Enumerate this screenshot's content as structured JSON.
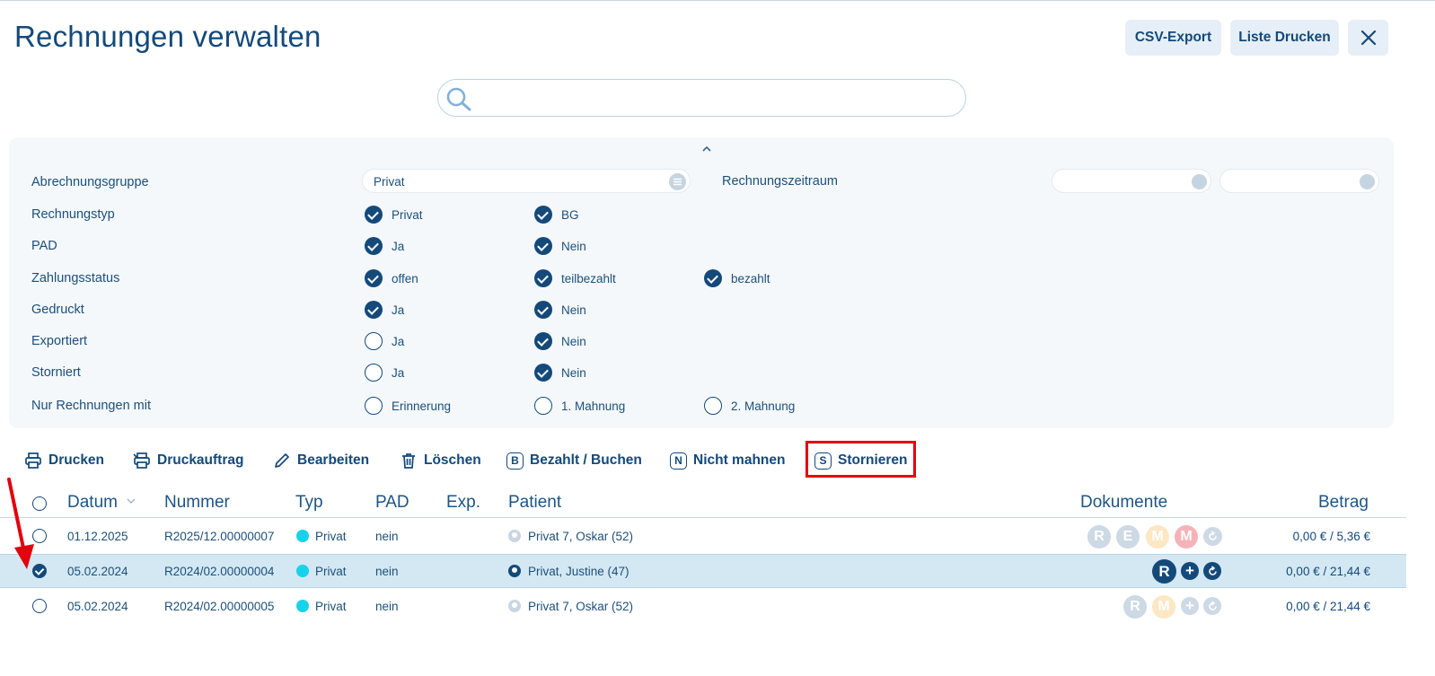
{
  "header": {
    "title": "Rechnungen verwalten",
    "csv_export_label": "CSV-Export",
    "print_list_label": "Liste Drucken",
    "close_label": "✕"
  },
  "search": {
    "value": "",
    "placeholder": ""
  },
  "filters": {
    "collapse_label": "⌃",
    "abrechnungsgruppe": {
      "label": "Abrechnungsgruppe",
      "value": "Privat"
    },
    "rechnungszeitraum": {
      "label": "Rechnungszeitraum",
      "from": "",
      "to": ""
    },
    "rechnungstyp": {
      "label": "Rechnungstyp",
      "options": [
        {
          "label": "Privat",
          "checked": true
        },
        {
          "label": "BG",
          "checked": true
        }
      ]
    },
    "pad": {
      "label": "PAD",
      "options": [
        {
          "label": "Ja",
          "checked": true
        },
        {
          "label": "Nein",
          "checked": true
        }
      ]
    },
    "zahlungsstatus": {
      "label": "Zahlungsstatus",
      "options": [
        {
          "label": "offen",
          "checked": true
        },
        {
          "label": "teilbezahlt",
          "checked": true
        },
        {
          "label": "bezahlt",
          "checked": true
        }
      ]
    },
    "gedruckt": {
      "label": "Gedruckt",
      "options": [
        {
          "label": "Ja",
          "checked": true
        },
        {
          "label": "Nein",
          "checked": true
        }
      ]
    },
    "exportiert": {
      "label": "Exportiert",
      "options": [
        {
          "label": "Ja",
          "checked": false
        },
        {
          "label": "Nein",
          "checked": true
        }
      ]
    },
    "storniert": {
      "label": "Storniert",
      "options": [
        {
          "label": "Ja",
          "checked": false
        },
        {
          "label": "Nein",
          "checked": true
        }
      ]
    },
    "nur_mit": {
      "label": "Nur Rechnungen mit",
      "options": [
        {
          "label": "Erinnerung",
          "checked": false
        },
        {
          "label": "1. Mahnung",
          "checked": false
        },
        {
          "label": "2. Mahnung",
          "checked": false
        }
      ]
    }
  },
  "toolbar": {
    "drucken": "Drucken",
    "druckauftrag": "Druckauftrag",
    "bearbeiten": "Bearbeiten",
    "loeschen": "Löschen",
    "bezahlt": "Bezahlt / Buchen",
    "bezahlt_letter": "B",
    "nicht_mahnen": "Nicht mahnen",
    "nicht_mahnen_letter": "N",
    "stornieren": "Stornieren",
    "stornieren_letter": "S"
  },
  "table": {
    "columns": {
      "datum": "Datum",
      "nummer": "Nummer",
      "typ": "Typ",
      "pad": "PAD",
      "exp": "Exp.",
      "patient": "Patient",
      "dokumente": "Dokumente",
      "betrag": "Betrag"
    },
    "rows": [
      {
        "selected": false,
        "datum": "01.12.2025",
        "nummer": "R2025/12.00000007",
        "typ": "Privat",
        "pad": "nein",
        "exp": "",
        "patient": "Privat 7, Oskar (52)",
        "betrag": "0,00 € / 5,36 €"
      },
      {
        "selected": true,
        "datum": "05.02.2024",
        "nummer": "R2024/02.00000004",
        "typ": "Privat",
        "pad": "nein",
        "exp": "",
        "patient": "Privat, Justine (47)",
        "betrag": "0,00 € / 21,44 €"
      },
      {
        "selected": false,
        "datum": "05.02.2024",
        "nummer": "R2024/02.00000005",
        "typ": "Privat",
        "pad": "nein",
        "exp": "",
        "patient": "Privat 7, Oskar (52)",
        "betrag": "0,00 € / 21,44 €"
      }
    ],
    "doc_letters": {
      "r": "R",
      "e": "E",
      "m": "M",
      "plus": "+"
    }
  },
  "colors": {
    "primary": "#14497a",
    "accent_typ": "#18d2ea",
    "selected_row": "#d3e8f3",
    "highlight": "#e3000f",
    "annotation_arrow": "#e3000f"
  }
}
